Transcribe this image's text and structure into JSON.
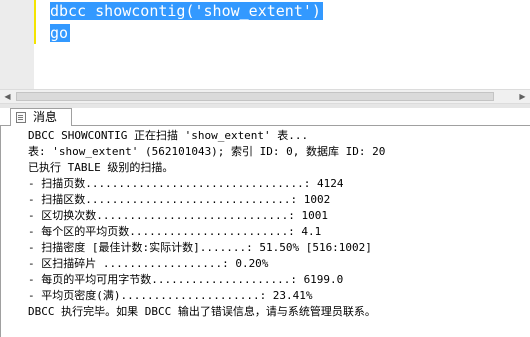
{
  "editor": {
    "lines": [
      "dbcc showcontig('show_extent')",
      "go"
    ]
  },
  "results": {
    "tab_label": "消息",
    "messages": [
      "DBCC SHOWCONTIG 正在扫描 'show_extent' 表...",
      "表: 'show_extent' (562101043); 索引 ID: 0, 数据库 ID: 20",
      "已执行 TABLE 级别的扫描。",
      "- 扫描页数.................................: 4124",
      "- 扫描区数...............................: 1002",
      "- 区切换次数.............................: 1001",
      "- 每个区的平均页数........................: 4.1",
      "- 扫描密度 [最佳计数:实际计数].......: 51.50% [516:1002]",
      "- 区扫描碎片 ..................: 0.20%",
      "- 每页的平均可用字节数.....................: 6199.0",
      "- 平均页密度(满).....................: 23.41%",
      "DBCC 执行完毕。如果 DBCC 输出了错误信息，请与系统管理员联系。"
    ]
  },
  "colors": {
    "selection": "#3399ff",
    "change_bar": "#f4e400",
    "gutter": "#ececec"
  },
  "icons": {
    "scroll_left": "scroll-left-arrow-icon",
    "scroll_right": "scroll-right-arrow-icon",
    "messages_tab": "messages-page-icon"
  }
}
